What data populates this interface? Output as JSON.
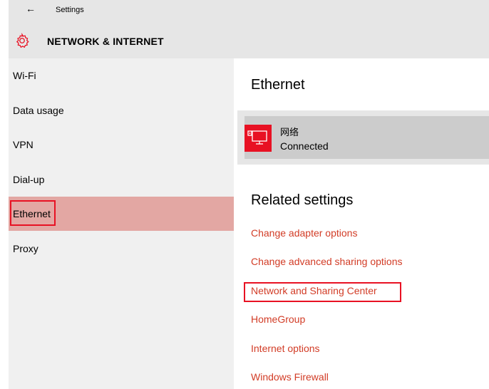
{
  "titlebar": {
    "back_icon": "←",
    "app_title": "Settings"
  },
  "header": {
    "icon": "gear-icon",
    "title": "NETWORK & INTERNET"
  },
  "sidebar": {
    "items": [
      {
        "label": "Wi-Fi"
      },
      {
        "label": "Data usage"
      },
      {
        "label": "VPN"
      },
      {
        "label": "Dial-up"
      },
      {
        "label": "Ethernet",
        "selected": true
      },
      {
        "label": "Proxy"
      }
    ]
  },
  "main": {
    "title": "Ethernet",
    "connection": {
      "name": "网络",
      "status": "Connected",
      "icon": "ethernet-icon"
    },
    "related_title": "Related settings",
    "links": [
      "Change adapter options",
      "Change advanced sharing options",
      "Network and Sharing Center",
      "HomeGroup",
      "Internet options",
      "Windows Firewall"
    ]
  },
  "colors": {
    "accent": "#d23c26",
    "highlight": "#e81123",
    "selected_bg": "#e3a7a3"
  }
}
